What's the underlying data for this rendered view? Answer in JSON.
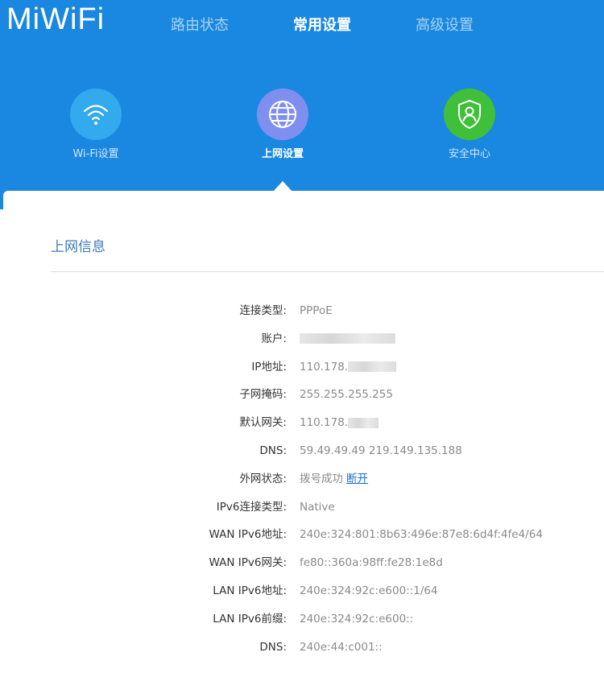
{
  "header": {
    "logo": "MiWiFi",
    "tabs": [
      {
        "label": "路由状态"
      },
      {
        "label": "常用设置"
      },
      {
        "label": "高级设置"
      }
    ]
  },
  "features": [
    {
      "label": "Wi-Fi设置",
      "icon": "wifi-icon",
      "color": "#33a9ee"
    },
    {
      "label": "上网设置",
      "icon": "globe-icon",
      "color": "#7f8ff0"
    },
    {
      "label": "安全中心",
      "icon": "shield-user-icon",
      "color": "#3fbf3a"
    }
  ],
  "section": {
    "title": "上网信息"
  },
  "info": {
    "connection_type": {
      "label": "连接类型:",
      "value": "PPPoE"
    },
    "account": {
      "label": "账户:"
    },
    "ip": {
      "label": "IP地址:",
      "value": "110.178."
    },
    "subnet": {
      "label": "子网掩码:",
      "value": "255.255.255.255"
    },
    "gateway": {
      "label": "默认网关:",
      "value": "110.178."
    },
    "dns": {
      "label": "DNS:",
      "value": "59.49.49.49 219.149.135.188"
    },
    "wan_status": {
      "label": "外网状态:",
      "value": "拨号成功",
      "action": "断开"
    },
    "ipv6_type": {
      "label": "IPv6连接类型:",
      "value": "Native"
    },
    "wan_ipv6_addr": {
      "label": "WAN IPv6地址:",
      "value": "240e:324:801:8b63:496e:87e8:6d4f:4fe4/64"
    },
    "wan_ipv6_gw": {
      "label": "WAN IPv6网关:",
      "value": "fe80::360a:98ff:fe28:1e8d"
    },
    "lan_ipv6_addr": {
      "label": "LAN IPv6地址:",
      "value": "240e:324:92c:e600::1/64"
    },
    "lan_ipv6_prefix": {
      "label": "LAN IPv6前缀:",
      "value": "240e:324:92c:e600::"
    },
    "dns6": {
      "label": "DNS:",
      "value": "240e:44:c001::"
    }
  },
  "colors": {
    "header_bg": "#1a88e0",
    "section_title": "#3c7ab5",
    "link": "#1a6fd0"
  }
}
